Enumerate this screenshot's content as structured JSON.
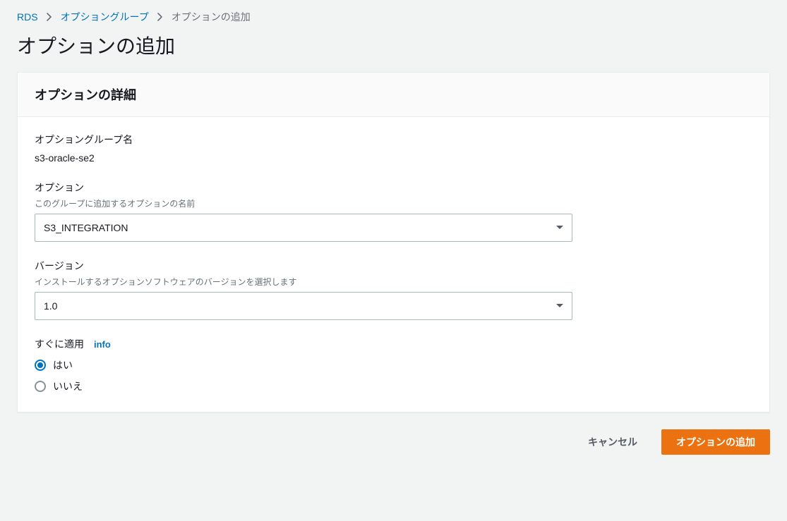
{
  "breadcrumb": {
    "root": "RDS",
    "group": "オプショングループ",
    "current": "オプションの追加"
  },
  "page": {
    "title": "オプションの追加"
  },
  "panel": {
    "title": "オプションの詳細"
  },
  "fields": {
    "group_name_label": "オプショングループ名",
    "group_name_value": "s3-oracle-se2",
    "option_label": "オプション",
    "option_hint": "このグループに追加するオプションの名前",
    "option_value": "S3_INTEGRATION",
    "version_label": "バージョン",
    "version_hint": "インストールするオプションソフトウェアのバージョンを選択します",
    "version_value": "1.0",
    "apply_label": "すぐに適用",
    "info_link": "info",
    "radio_yes": "はい",
    "radio_no": "いいえ"
  },
  "actions": {
    "cancel": "キャンセル",
    "submit": "オプションの追加"
  }
}
